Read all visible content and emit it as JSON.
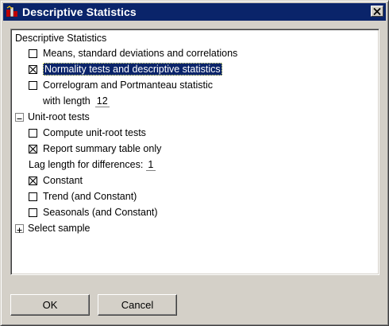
{
  "window": {
    "title": "Descriptive Statistics"
  },
  "tree": {
    "section1": {
      "label": "Descriptive Statistics",
      "items": [
        {
          "label": "Means, standard deviations and correlations",
          "checked": false
        },
        {
          "label": "Normality tests and descriptive statistics",
          "checked": true,
          "selected": true
        },
        {
          "label": "Correlogram and Portmanteau statistic",
          "checked": false
        }
      ],
      "length_label": "with length",
      "length_value": "12"
    },
    "section2": {
      "label": "Unit-root tests",
      "expander": "minus",
      "items_a": [
        {
          "label": "Compute unit-root tests",
          "checked": false
        },
        {
          "label": "Report summary table only",
          "checked": true
        }
      ],
      "lag_label": "Lag length for differences:",
      "lag_value": "1",
      "items_b": [
        {
          "label": "Constant",
          "checked": true
        },
        {
          "label": "Trend (and Constant)",
          "checked": false
        },
        {
          "label": "Seasonals (and Constant)",
          "checked": false
        }
      ]
    },
    "section3": {
      "label": "Select sample",
      "expander": "plus"
    }
  },
  "buttons": {
    "ok": "OK",
    "cancel": "Cancel"
  }
}
